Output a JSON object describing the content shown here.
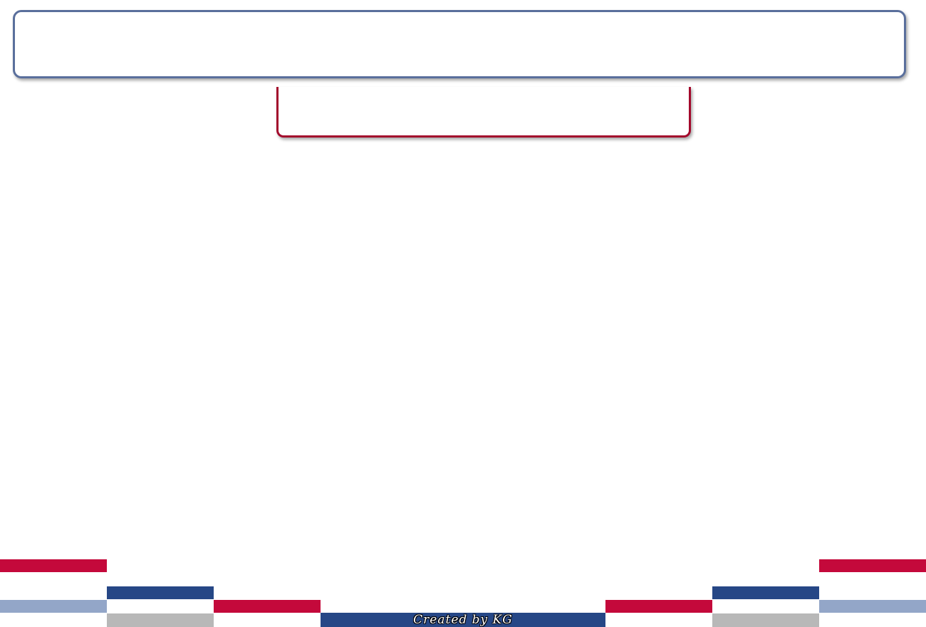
{
  "slide": {
    "title": "",
    "subtitle": ""
  },
  "footer": {
    "credit": "Created by KG"
  },
  "colors": {
    "title_border": "#5a6f9c",
    "subtitle_border": "#a3092c",
    "red": "#c4093b",
    "navy": "#264786",
    "light_blue": "#93a6c8",
    "grey": "#b8b8b8"
  }
}
